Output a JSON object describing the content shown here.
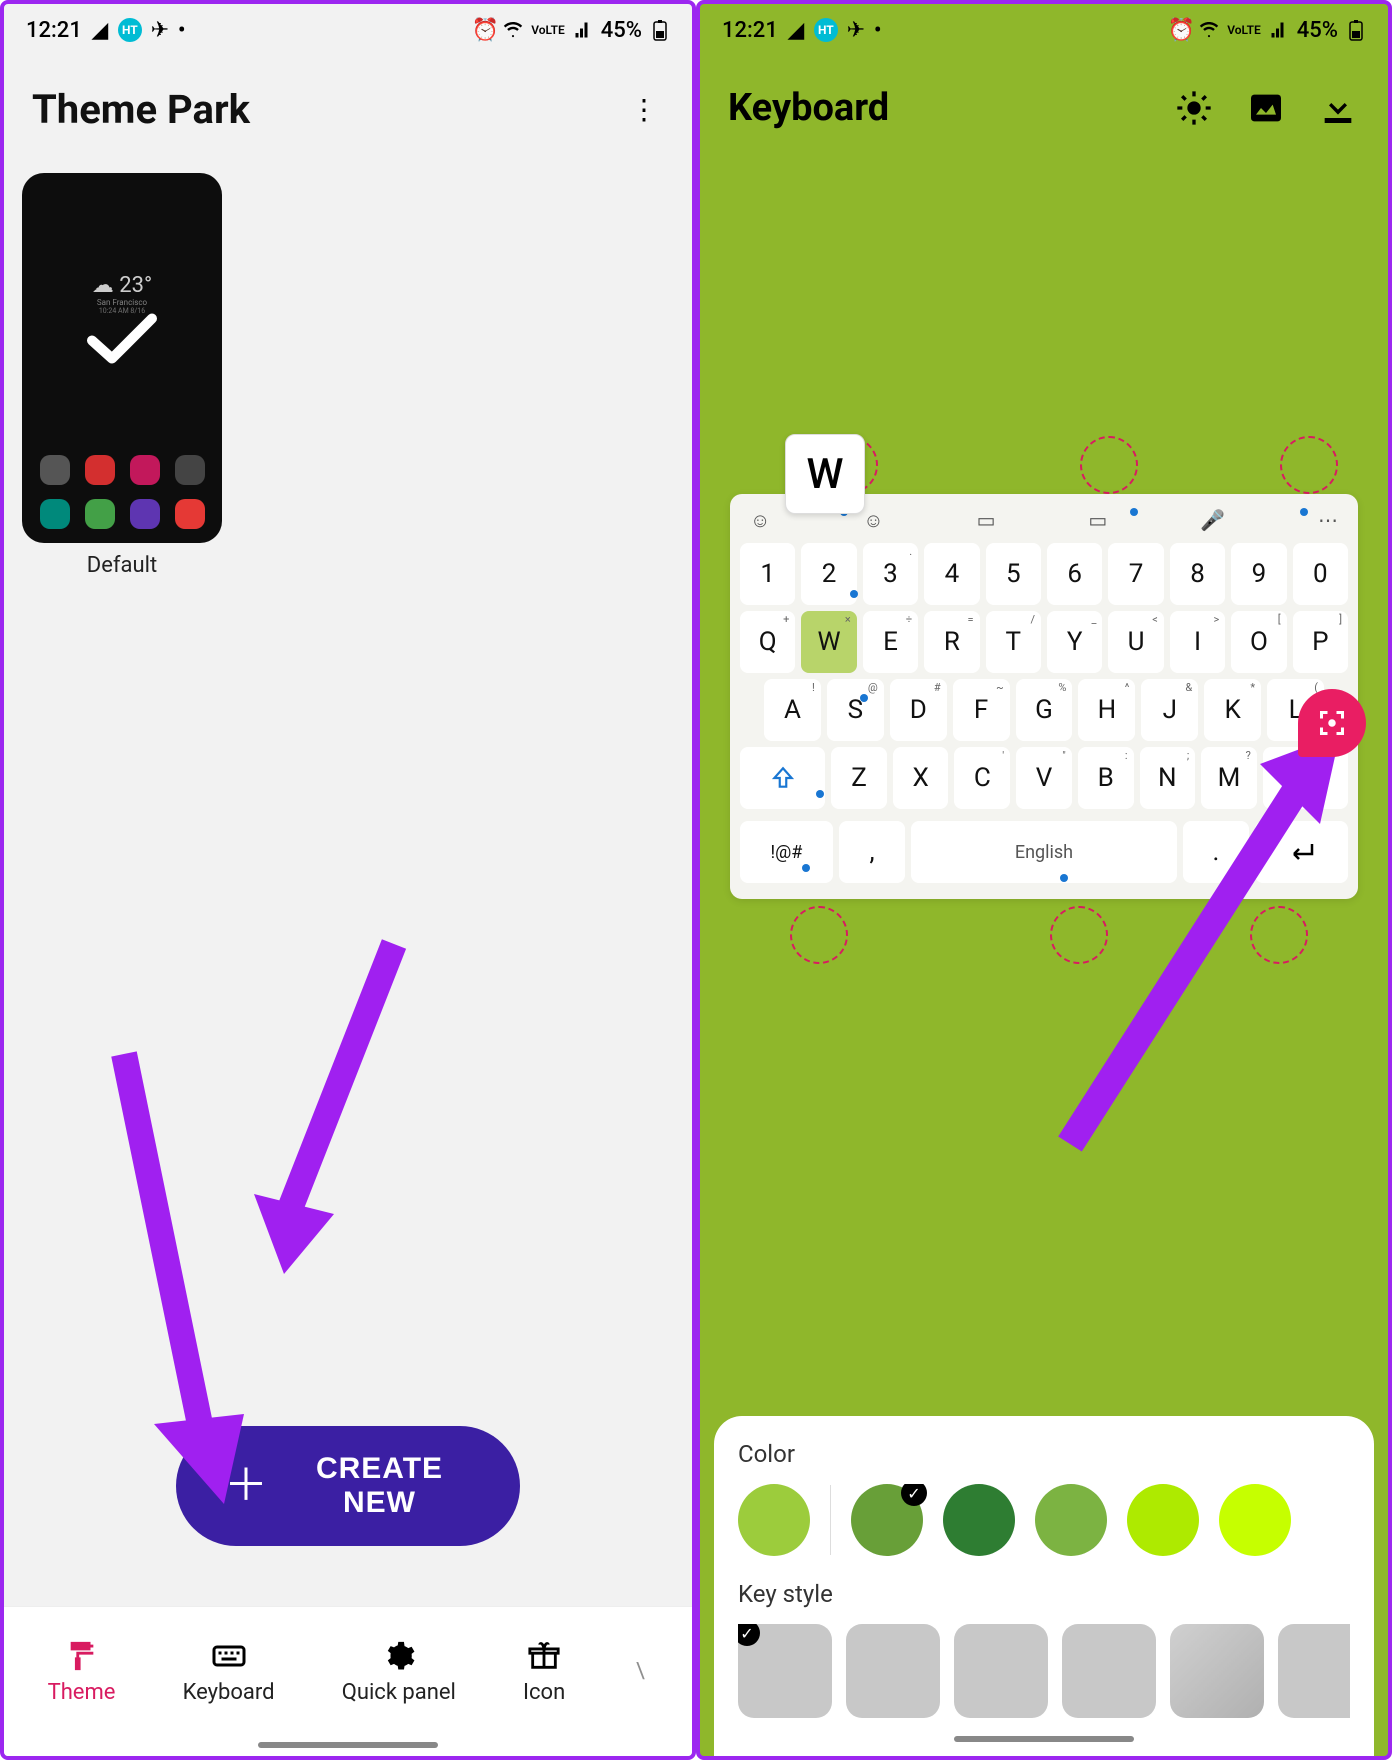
{
  "status": {
    "time": "12:21",
    "battery": "45%",
    "net_label": "VoLTE"
  },
  "left": {
    "title": "Theme Park",
    "thumb_label": "Default",
    "thumb_temp": "23°",
    "create_label": "CREATE NEW",
    "tabs": {
      "theme": "Theme",
      "keyboard": "Keyboard",
      "quick_panel": "Quick panel",
      "icon": "Icon"
    }
  },
  "right": {
    "title": "Keyboard",
    "popup_key": "W",
    "space_label": "English",
    "sym_key": "!@#",
    "panel": {
      "color_label": "Color",
      "key_style_label": "Key style",
      "colors": [
        "#9ccc3c",
        "#689f38",
        "#2e7d32",
        "#7cb342",
        "#aeea00",
        "#c6ff00"
      ]
    },
    "rows": {
      "numbers": [
        "1",
        "2",
        "3",
        "4",
        "5",
        "6",
        "7",
        "8",
        "9",
        "0"
      ],
      "num_sup": [
        "",
        "",
        ".",
        "",
        "",
        "",
        "",
        "",
        "",
        ""
      ],
      "row1": [
        "Q",
        "W",
        "E",
        "R",
        "T",
        "Y",
        "U",
        "I",
        "O",
        "P"
      ],
      "row1_sup": [
        "+",
        "×",
        "÷",
        "=",
        "/",
        "_",
        "<",
        ">",
        "[",
        "]"
      ],
      "row2": [
        "A",
        "S",
        "D",
        "F",
        "G",
        "H",
        "J",
        "K",
        "L"
      ],
      "row2_sup": [
        "!",
        "@",
        "#",
        "~",
        "%",
        "^",
        "&",
        "*",
        "("
      ],
      "row3": [
        "Z",
        "X",
        "C",
        "V",
        "B",
        "N",
        "M"
      ],
      "row3_sup": [
        "",
        "",
        "'",
        "\"",
        ":",
        ";",
        "?"
      ]
    }
  }
}
